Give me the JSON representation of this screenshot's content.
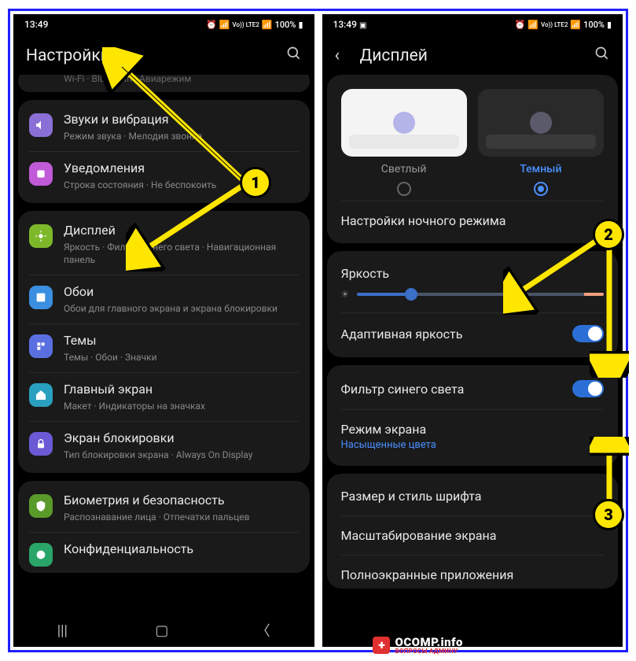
{
  "status": {
    "time": "13:49",
    "battery": "100%",
    "net": "Vo)) LTE2"
  },
  "left": {
    "title": "Настройки",
    "partial": "Wi-Fi  ·  Bluetooth  ·  Авиарежим",
    "sections": [
      {
        "icon": "sound-icon",
        "bg": "#8a6fd6",
        "title": "Звуки и вибрация",
        "sub": "Режим звука  ·  Мелодия звонка"
      },
      {
        "icon": "notification-icon",
        "bg": "#c05ad6",
        "title": "Уведомления",
        "sub": "Строка состояния  ·  Не беспокоить"
      }
    ],
    "sections2": [
      {
        "icon": "display-icon",
        "bg": "#7db82a",
        "title": "Дисплей",
        "sub": "Яркость  ·  Фильтр синего света  ·  Навигационная панель"
      },
      {
        "icon": "wallpaper-icon",
        "bg": "#3b8fe0",
        "title": "Обои",
        "sub": "Обои для главного экрана и экрана блокировки"
      },
      {
        "icon": "themes-icon",
        "bg": "#5a6fe0",
        "title": "Темы",
        "sub": "Темы  ·  Обои  ·  Значки"
      },
      {
        "icon": "home-icon",
        "bg": "#2aa0c0",
        "title": "Главный экран",
        "sub": "Макет  ·  Индикаторы на значках"
      },
      {
        "icon": "lock-icon",
        "bg": "#6a5ad6",
        "title": "Экран блокировки",
        "sub": "Тип блокировки экрана  ·  Always On Display"
      }
    ],
    "sections3": [
      {
        "icon": "biometrics-icon",
        "bg": "#5a9a2a",
        "title": "Биометрия и безопасность",
        "sub": "Распознавание лица  ·  Отпечатки пальцев"
      },
      {
        "icon": "privacy-icon",
        "bg": "#2aa56a",
        "title": "Конфиденциальность",
        "sub": ""
      }
    ]
  },
  "right": {
    "title": "Дисплей",
    "theme": {
      "light": "Светлый",
      "dark": "Темный"
    },
    "night": "Настройки ночного режима",
    "brightness": "Яркость",
    "adaptive": "Адаптивная яркость",
    "bluefilter": "Фильтр синего света",
    "screenmode": {
      "t": "Режим экрана",
      "s": "Насыщенные цвета"
    },
    "font": "Размер и стиль шрифта",
    "zoom": "Масштабирование экрана",
    "fullscreen": "Полноэкранные приложения"
  },
  "callouts": {
    "c1": "1",
    "c2": "2",
    "c3": "3"
  },
  "watermark": {
    "site": "OCOMP.info",
    "tag": "ВОПРОСЫ АДМИНУ",
    "plus": "+"
  }
}
